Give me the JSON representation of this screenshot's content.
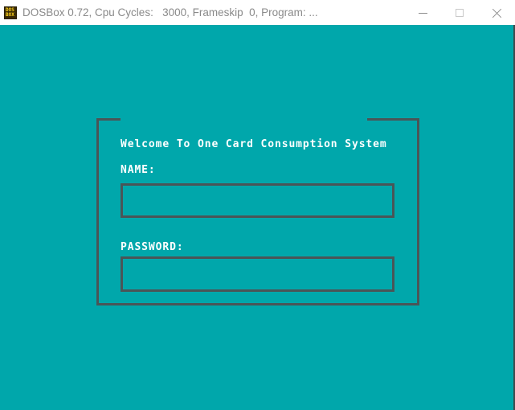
{
  "window": {
    "title": "DOSBox 0.72, Cpu Cycles:   3000, Frameskip  0, Program: ...",
    "icon_name": "dosbox-icon",
    "icon_line1": "DOS",
    "icon_line2": "BOX",
    "controls": {
      "minimize_label": "Minimize",
      "maximize_label": "Maximize",
      "close_label": "Close"
    },
    "titlebar_bg": "#ffffff",
    "titlebar_text_color": "#8a8a8a"
  },
  "screen": {
    "background_color": "#00a7ab",
    "border_color": "#4a5557",
    "text_color": "#ffffff"
  },
  "form": {
    "title": "Welcome To One Card Consumption System",
    "fields": [
      {
        "label": "NAME:",
        "value": "",
        "placeholder": ""
      },
      {
        "label": "PASSWORD:",
        "value": "",
        "placeholder": ""
      }
    ]
  }
}
